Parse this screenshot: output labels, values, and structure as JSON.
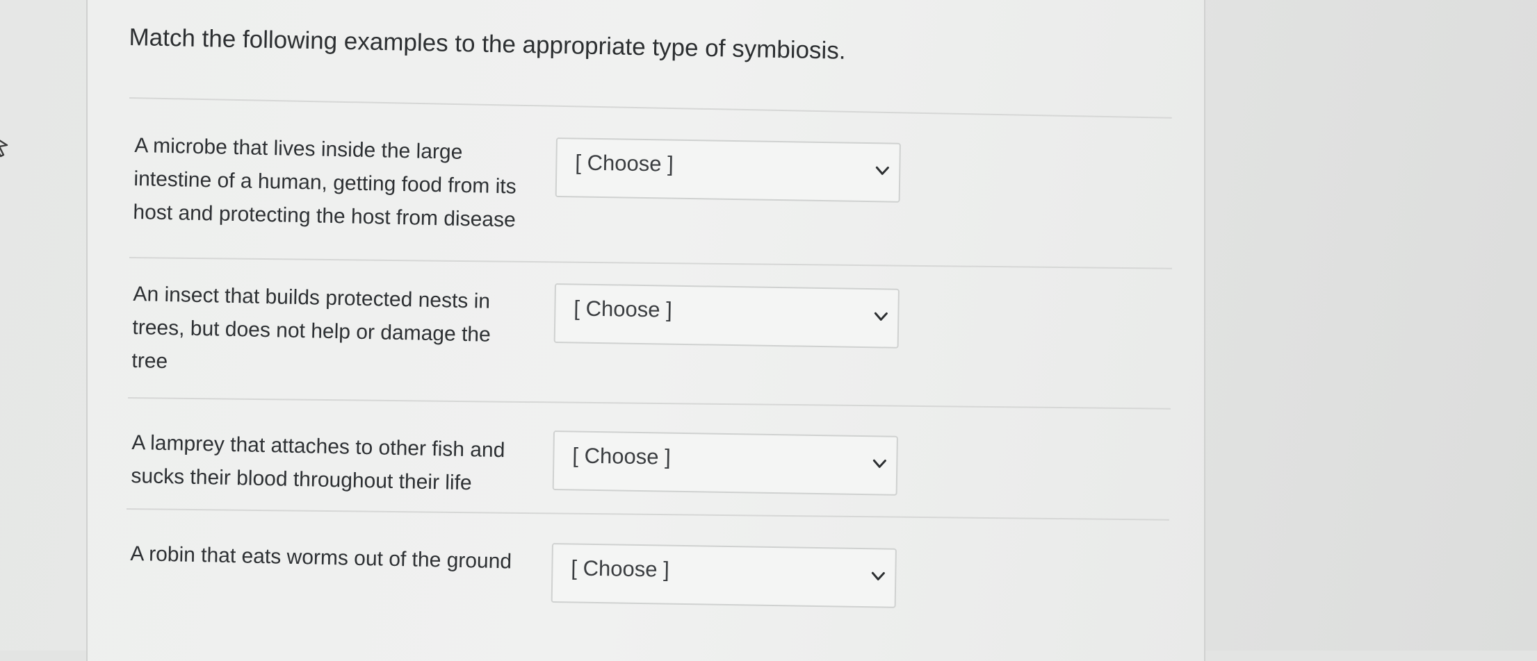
{
  "question": {
    "title": "Match the following examples to the appropriate type of symbiosis."
  },
  "items": [
    {
      "lines": [
        "A microbe that lives inside the large",
        "intestine of a human, getting food from its",
        "host and protecting the host from disease"
      ],
      "selected": "[ Choose ]"
    },
    {
      "lines": [
        "An insect that builds protected nests in",
        "trees, but does not help or damage the",
        "tree"
      ],
      "selected": "[ Choose ]"
    },
    {
      "lines": [
        "A lamprey that attaches to other fish and",
        "sucks their blood throughout their life"
      ],
      "selected": "[ Choose ]"
    },
    {
      "lines": [
        "A robin that eats worms out of the ground"
      ],
      "selected": "[ Choose ]"
    }
  ],
  "colors": {
    "text": "#2d3033",
    "border": "#cfd1d0",
    "card": "#eeefee"
  },
  "icons": {
    "cursor": "mouse-cursor-icon",
    "dropdown": "chevron-down-icon"
  }
}
